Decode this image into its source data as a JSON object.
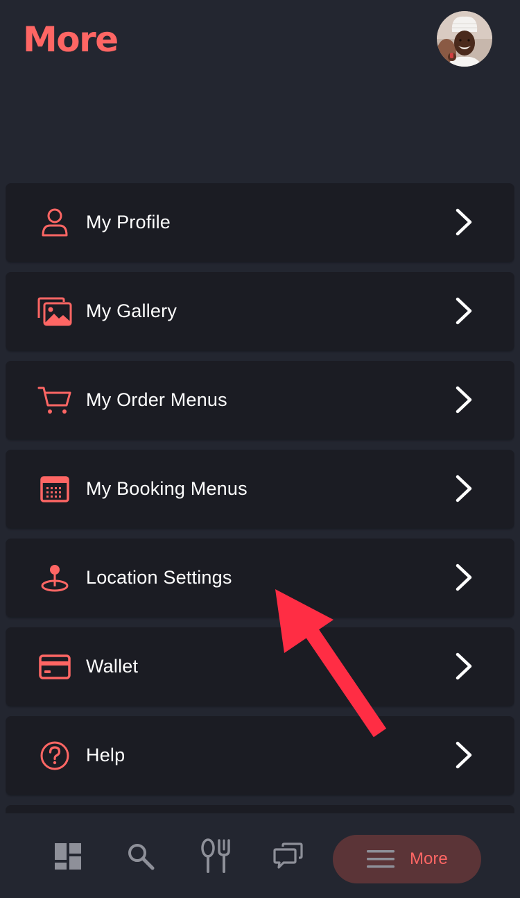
{
  "header": {
    "title": "More",
    "avatar_icon": "chef-avatar-photo"
  },
  "menu": {
    "items": [
      {
        "label": "My Profile",
        "icon": "person-icon"
      },
      {
        "label": "My Gallery",
        "icon": "gallery-icon"
      },
      {
        "label": "My Order Menus",
        "icon": "cart-icon"
      },
      {
        "label": "My Booking Menus",
        "icon": "calendar-icon"
      },
      {
        "label": "Location Settings",
        "icon": "location-pin-icon"
      },
      {
        "label": "Wallet",
        "icon": "credit-card-icon"
      },
      {
        "label": "Help",
        "icon": "help-circle-icon"
      }
    ],
    "chevron_icon": "chevron-right-icon"
  },
  "bottom_nav": {
    "items": [
      {
        "icon": "dashboard-icon"
      },
      {
        "icon": "search-icon"
      },
      {
        "icon": "fork-spoon-icon"
      },
      {
        "icon": "chat-icon"
      }
    ],
    "active": {
      "label": "More",
      "icon": "hamburger-menu-icon"
    }
  },
  "annotation": {
    "icon": "red-arrow-pointer"
  },
  "colors": {
    "accent": "#fe6664",
    "background": "#232630",
    "card": "#1b1c23",
    "active_pill": "#5b3437",
    "arrow": "#ff2d44",
    "text": "#ffffff",
    "nav_icon": "#8e9099"
  }
}
